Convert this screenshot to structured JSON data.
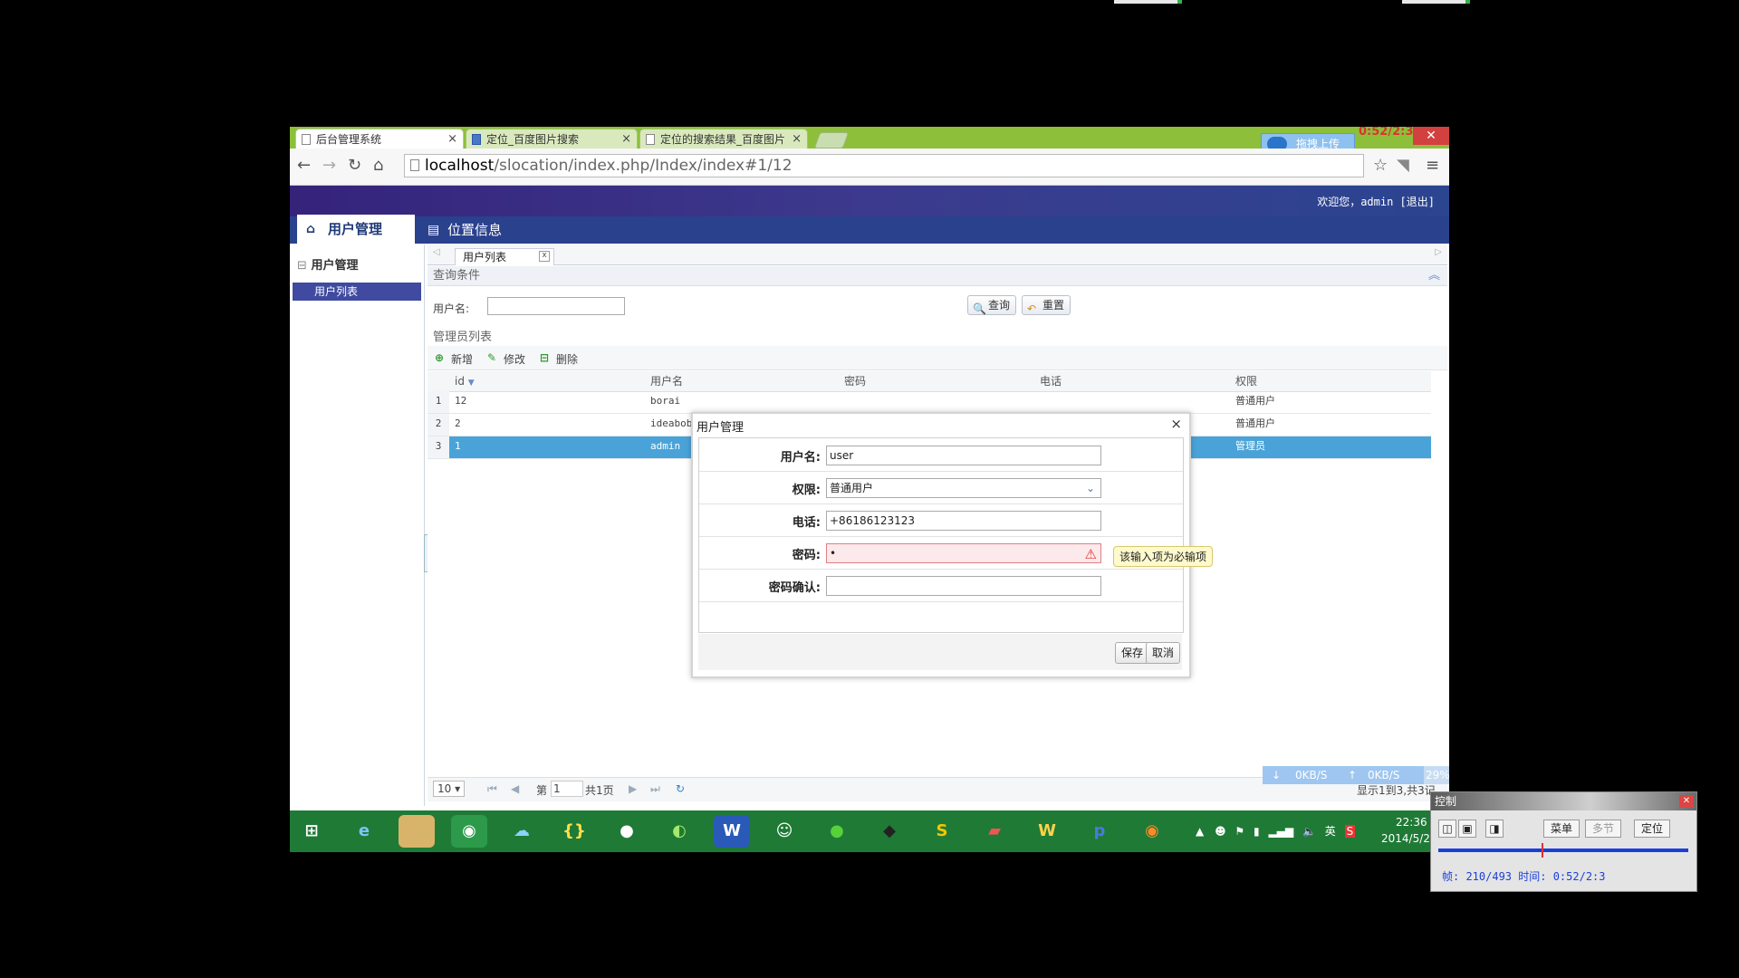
{
  "browser": {
    "tabs": [
      {
        "title": "后台管理系统"
      },
      {
        "title": "定位_百度图片搜索"
      },
      {
        "title": "定位的搜索结果_百度图片"
      }
    ],
    "tab_close": "×",
    "upload_label": "拖拽上传",
    "timer_text": "0:52/2:3",
    "url_host": "localhost",
    "url_path": "/slocation/index.php/Index/index#1/12"
  },
  "app": {
    "welcome": "欢迎您，admin [退出]",
    "nav_tabs": [
      "用户管理",
      "位置信息"
    ],
    "sidebar_title": "用户管理",
    "sidebar_item": "用户列表",
    "content_tab": "用户列表",
    "query_title": "查询条件",
    "username_label": "用户名:",
    "search_button": "查询",
    "reset_button": "重置",
    "list_title": "管理员列表",
    "toolbar": {
      "add": "新增",
      "edit": "修改",
      "delete": "删除"
    }
  },
  "grid": {
    "columns": [
      "id",
      "用户名",
      "密码",
      "电话",
      "权限"
    ],
    "rows": [
      {
        "num": "1",
        "id": "12",
        "username": "borai",
        "role": "普通用户"
      },
      {
        "num": "2",
        "id": "2",
        "username": "ideabobo",
        "role": "普通用户"
      },
      {
        "num": "3",
        "id": "1",
        "username": "admin",
        "role": "管理员"
      }
    ],
    "selected_row": 3
  },
  "pager": {
    "page_size": "10",
    "page_prefix": "第",
    "page_number": "1",
    "page_total": "共1页",
    "summary": "显示1到3,共3记"
  },
  "netspeed": {
    "down": "0KB/S",
    "up": "0KB/S",
    "percent": "29%"
  },
  "modal": {
    "title": "用户管理",
    "fields": [
      {
        "label": "用户名:",
        "value": "user"
      },
      {
        "label": "权限:",
        "value": "普通用户"
      },
      {
        "label": "电话:",
        "value": "+86186123123"
      },
      {
        "label": "密码:",
        "value": "•"
      },
      {
        "label": "密码确认:",
        "value": ""
      }
    ],
    "validation_tip": "该输入项为必输项",
    "save_button": "保存",
    "cancel_button": "取消"
  },
  "taskbar": {
    "time": "22:36",
    "date": "2014/5/2",
    "ime": "英"
  },
  "control": {
    "title": "控制",
    "buttons": [
      "菜单",
      "多节",
      "定位"
    ],
    "info": "帧: 210/493 时间: 0:52/2:3"
  }
}
